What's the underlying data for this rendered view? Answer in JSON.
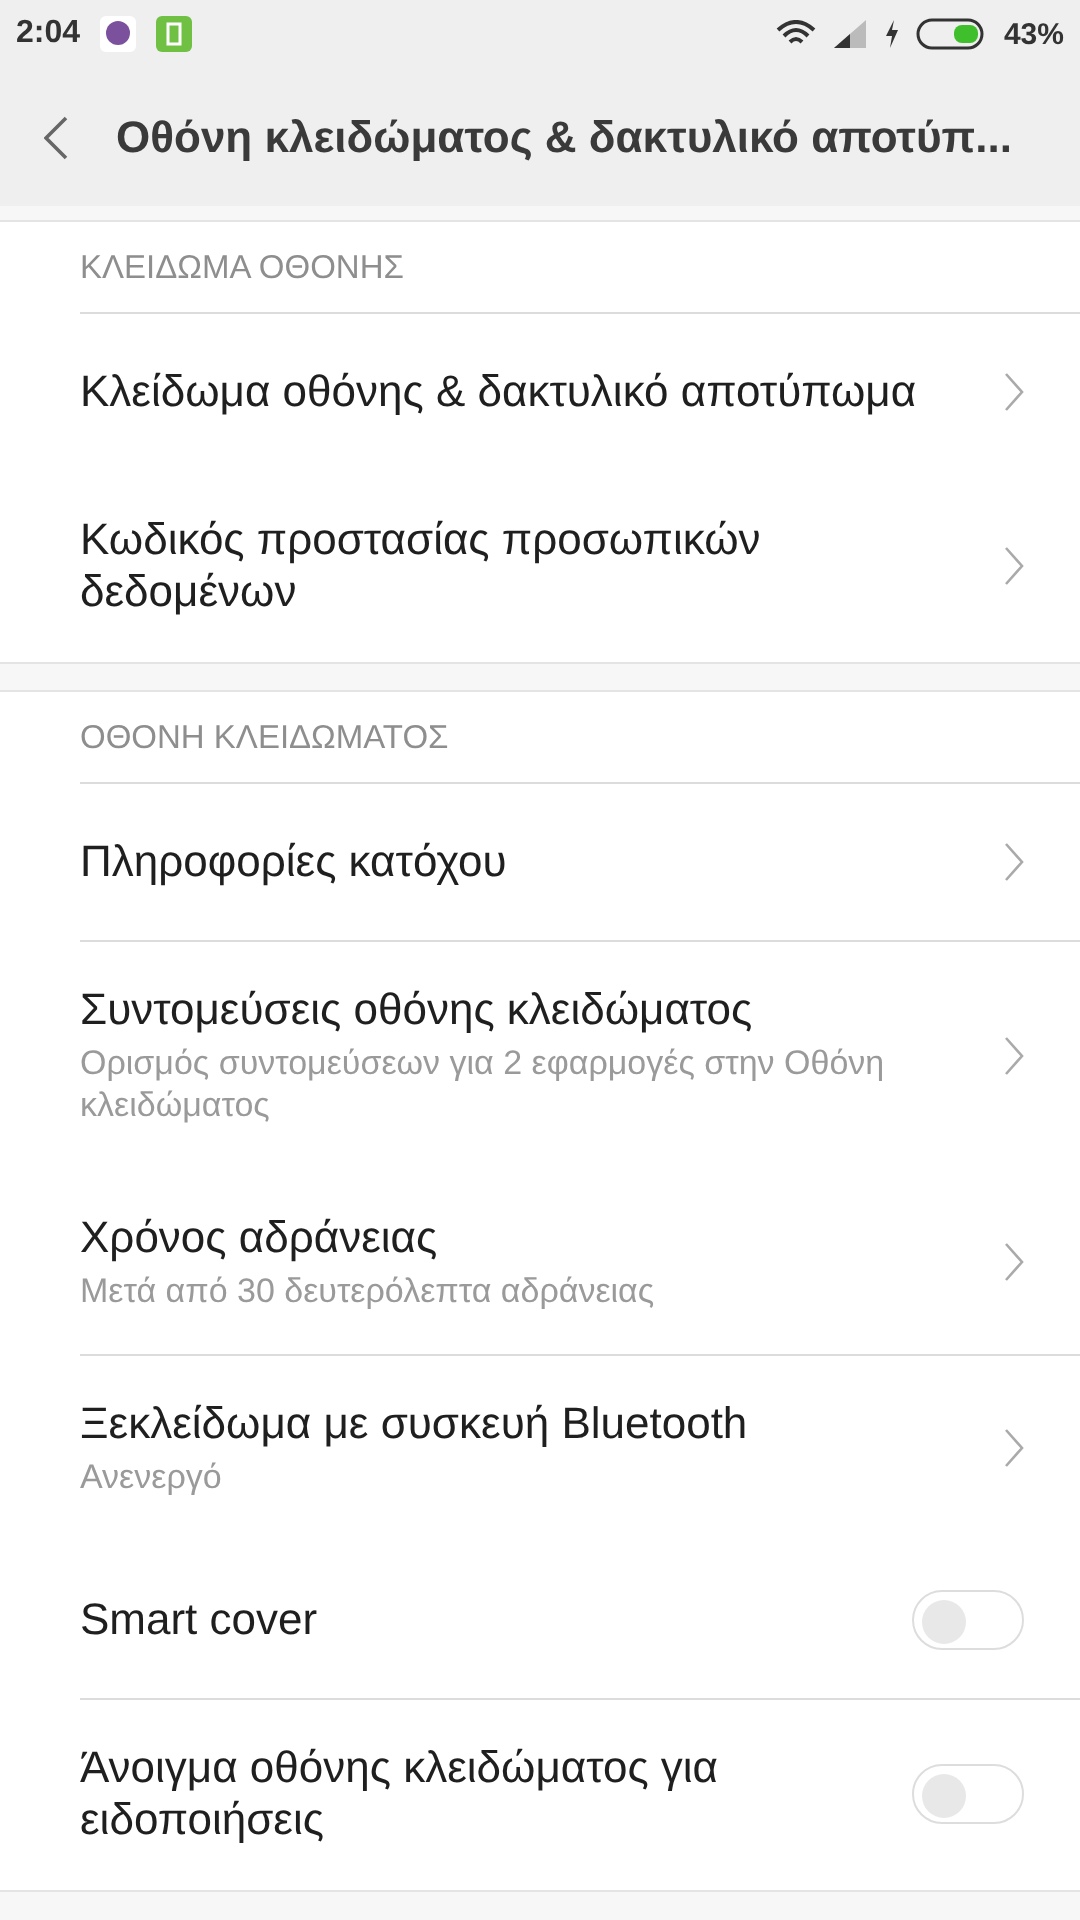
{
  "status_bar": {
    "time": "2:04",
    "battery": "43%"
  },
  "header": {
    "title": "Οθόνη κλειδώματος & δακτυλικό αποτύπ..."
  },
  "sections": [
    {
      "title": "ΚΛΕΙΔΩΜΑ ΟΘΟΝΗΣ",
      "items": [
        {
          "kind": "link",
          "title": "Κλείδωμα οθόνης & δακτυλικό αποτύπωμα",
          "divider_below": false
        },
        {
          "kind": "link",
          "title": "Κωδικός προστασίας προσωπικών δεδομένων",
          "divider_below": false
        }
      ]
    },
    {
      "title": "ΟΘΟΝΗ ΚΛΕΙΔΩΜΑΤΟΣ",
      "items": [
        {
          "kind": "link",
          "title": "Πληροφορίες κατόχου",
          "divider_below": true
        },
        {
          "kind": "link",
          "title": "Συντομεύσεις οθόνης κλειδώματος",
          "subtitle": "Ορισμός συντομεύσεων για 2 εφαρμογές στην Οθόνη κλειδώματος",
          "divider_below": false
        },
        {
          "kind": "link",
          "title": "Χρόνος αδράνειας",
          "subtitle": "Μετά από 30 δευτερόλεπτα αδράνειας",
          "divider_below": true
        },
        {
          "kind": "link",
          "title": "Ξεκλείδωμα με συσκευή Bluetooth",
          "subtitle": "Ανενεργό",
          "divider_below": false
        },
        {
          "kind": "toggle",
          "title": "Smart cover",
          "on": false,
          "divider_below": true
        },
        {
          "kind": "toggle",
          "title": "Άνοιγμα οθόνης κλειδώματος για ειδοποιήσεις",
          "on": false
        }
      ]
    }
  ]
}
